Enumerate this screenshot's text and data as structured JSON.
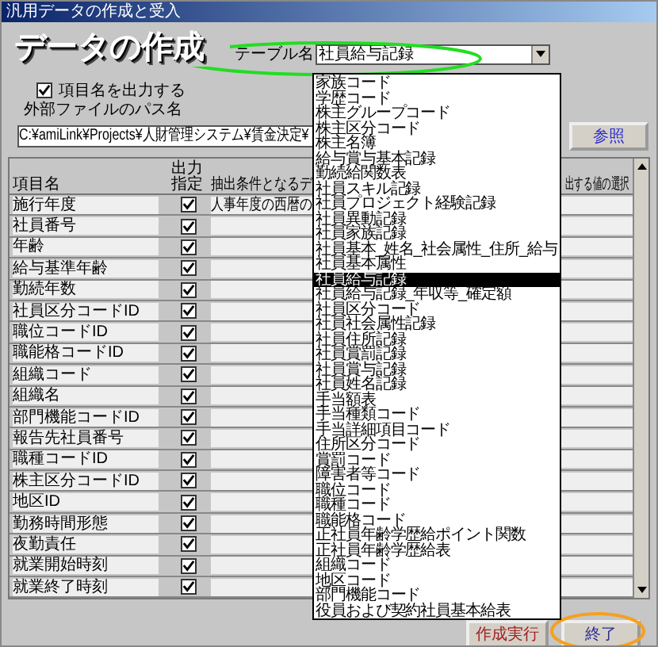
{
  "window": {
    "title": "汎用データの作成と受入"
  },
  "heading": "データの作成",
  "table_select": {
    "label": "テーブル名",
    "value": "社員給与記録",
    "circled": true,
    "expanded": true,
    "options": [
      {
        "label": "家族コード",
        "selected": false
      },
      {
        "label": "学歴コード",
        "selected": false
      },
      {
        "label": "株主グループコード",
        "selected": false
      },
      {
        "label": "株主区分コード",
        "selected": false
      },
      {
        "label": "株主名簿",
        "selected": false
      },
      {
        "label": "給与賞与基本記録",
        "selected": false
      },
      {
        "label": "勤続給関数表",
        "selected": false
      },
      {
        "label": "社員スキル記録",
        "selected": false
      },
      {
        "label": "社員プロジェクト経験記録",
        "selected": false
      },
      {
        "label": "社員異動記録",
        "selected": false
      },
      {
        "label": "社員家族記録",
        "selected": false
      },
      {
        "label": "社員基本_姓名_社会属性_住所_給与",
        "selected": false
      },
      {
        "label": "社員基本属性",
        "selected": false
      },
      {
        "label": "社員給与記録",
        "selected": true
      },
      {
        "label": "社員給与記録_年収等_確定額",
        "selected": false
      },
      {
        "label": "社員区分コード",
        "selected": false
      },
      {
        "label": "社員社会属性記録",
        "selected": false
      },
      {
        "label": "社員住所記録",
        "selected": false
      },
      {
        "label": "社員賞罰記録",
        "selected": false
      },
      {
        "label": "社員賞与記録",
        "selected": false
      },
      {
        "label": "社員姓名記録",
        "selected": false
      },
      {
        "label": "手当額表",
        "selected": false
      },
      {
        "label": "手当種類コード",
        "selected": false
      },
      {
        "label": "手当詳細項目コード",
        "selected": false
      },
      {
        "label": "住所区分コード",
        "selected": false
      },
      {
        "label": "賞罰コード",
        "selected": false
      },
      {
        "label": "障害者等コード",
        "selected": false
      },
      {
        "label": "職位コード",
        "selected": false
      },
      {
        "label": "職種コード",
        "selected": false
      },
      {
        "label": "職能格コード",
        "selected": false
      },
      {
        "label": "正社員年齢学歴給ポイント関数",
        "selected": false
      },
      {
        "label": "正社員年齢学歴給表",
        "selected": false
      },
      {
        "label": "組織コード",
        "selected": false
      },
      {
        "label": "地区コード",
        "selected": false
      },
      {
        "label": "部門機能コード",
        "selected": false
      },
      {
        "label": "役員および契約社員基本給表",
        "selected": false
      }
    ]
  },
  "output_names": {
    "label": "項目名を出力する",
    "checked": true
  },
  "path": {
    "label": "外部ファイルのパス名",
    "value": "C:¥amiLink¥Projects¥人財管理システム¥賃金決定¥"
  },
  "browse_button": "参照",
  "grid": {
    "columns": [
      "項目名",
      "出力指定",
      "抽出条件となるデ",
      "出する値の選択"
    ],
    "rows": [
      {
        "name": "施行年度",
        "output": true,
        "condition": "人事年度の西暦の"
      },
      {
        "name": "社員番号",
        "output": true
      },
      {
        "name": "年齢",
        "output": true
      },
      {
        "name": "給与基準年齢",
        "output": true
      },
      {
        "name": "勤続年数",
        "output": true
      },
      {
        "name": "社員区分コードID",
        "output": true
      },
      {
        "name": "職位コードID",
        "output": true
      },
      {
        "name": "職能格コードID",
        "output": true
      },
      {
        "name": "組織コード",
        "output": true
      },
      {
        "name": "組織名",
        "output": true
      },
      {
        "name": "部門機能コードID",
        "output": true
      },
      {
        "name": "報告先社員番号",
        "output": true
      },
      {
        "name": "職種コードID",
        "output": true
      },
      {
        "name": "株主区分コードID",
        "output": true
      },
      {
        "name": "地区ID",
        "output": true
      },
      {
        "name": "勤務時間形態",
        "output": true
      },
      {
        "name": "夜勤責任",
        "output": true
      },
      {
        "name": "就業開始時刻",
        "output": true
      },
      {
        "name": "就業終了時刻",
        "output": true
      }
    ]
  },
  "buttons": [
    {
      "label": "作成実行",
      "kind": "run",
      "circled": false
    },
    {
      "label": "終了",
      "kind": "close",
      "circled": true
    }
  ]
}
